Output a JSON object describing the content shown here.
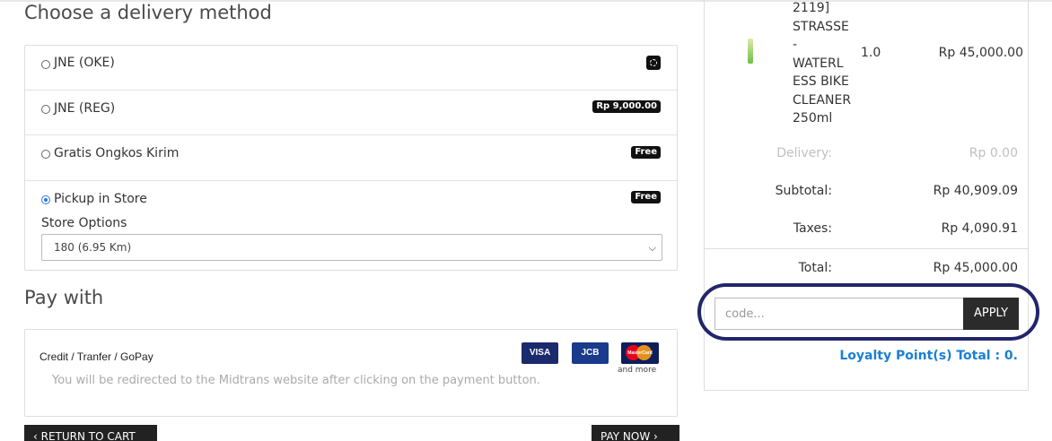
{
  "delivery": {
    "title": "Choose a delivery method",
    "methods": [
      {
        "label": "JNE (OKE)",
        "badge": "",
        "selected": false
      },
      {
        "label": "JNE (REG)",
        "badge": "Rp 9,000.00",
        "selected": false
      },
      {
        "label": "Gratis Ongkos Kirim",
        "badge": "Free",
        "selected": false
      },
      {
        "label": "Pickup in Store",
        "badge": "Free",
        "selected": true
      }
    ],
    "store_options_label": "Store Options",
    "store_selected": "180 (6.95 Km)"
  },
  "payment": {
    "title": "Pay with",
    "option_label": "Credit / Tranfer / GoPay",
    "note": "You will be redirected to the Midtrans website after clicking on the payment button.",
    "cards": [
      "VISA",
      "JCB",
      "MasterCard"
    ],
    "and_more": "and more"
  },
  "actions": {
    "return_label": "RETURN TO CART",
    "pay_label": "PAY NOW"
  },
  "summary": {
    "product": {
      "name_lines": [
        "2119]",
        "STRASSE",
        "-",
        "WATERL",
        "ESS BIKE",
        "CLEANER",
        "250ml"
      ],
      "qty": "1.0",
      "price": "Rp 45,000.00"
    },
    "delivery_label": "Delivery:",
    "delivery_value": "Rp 0.00",
    "subtotal_label": "Subtotal:",
    "subtotal_value": "Rp 40,909.09",
    "taxes_label": "Taxes:",
    "taxes_value": "Rp 4,090.91",
    "total_label": "Total:",
    "total_value": "Rp 45,000.00"
  },
  "promo": {
    "placeholder": "code...",
    "apply_label": "APPLY"
  },
  "loyalty": {
    "text": "Loyalty Point(s) Total : 0."
  },
  "colors": {
    "highlight_ring": "#23256b",
    "loyalty": "#1a7fd4",
    "radio_selected": "#2a7ae2",
    "button_dark": "#222222"
  }
}
